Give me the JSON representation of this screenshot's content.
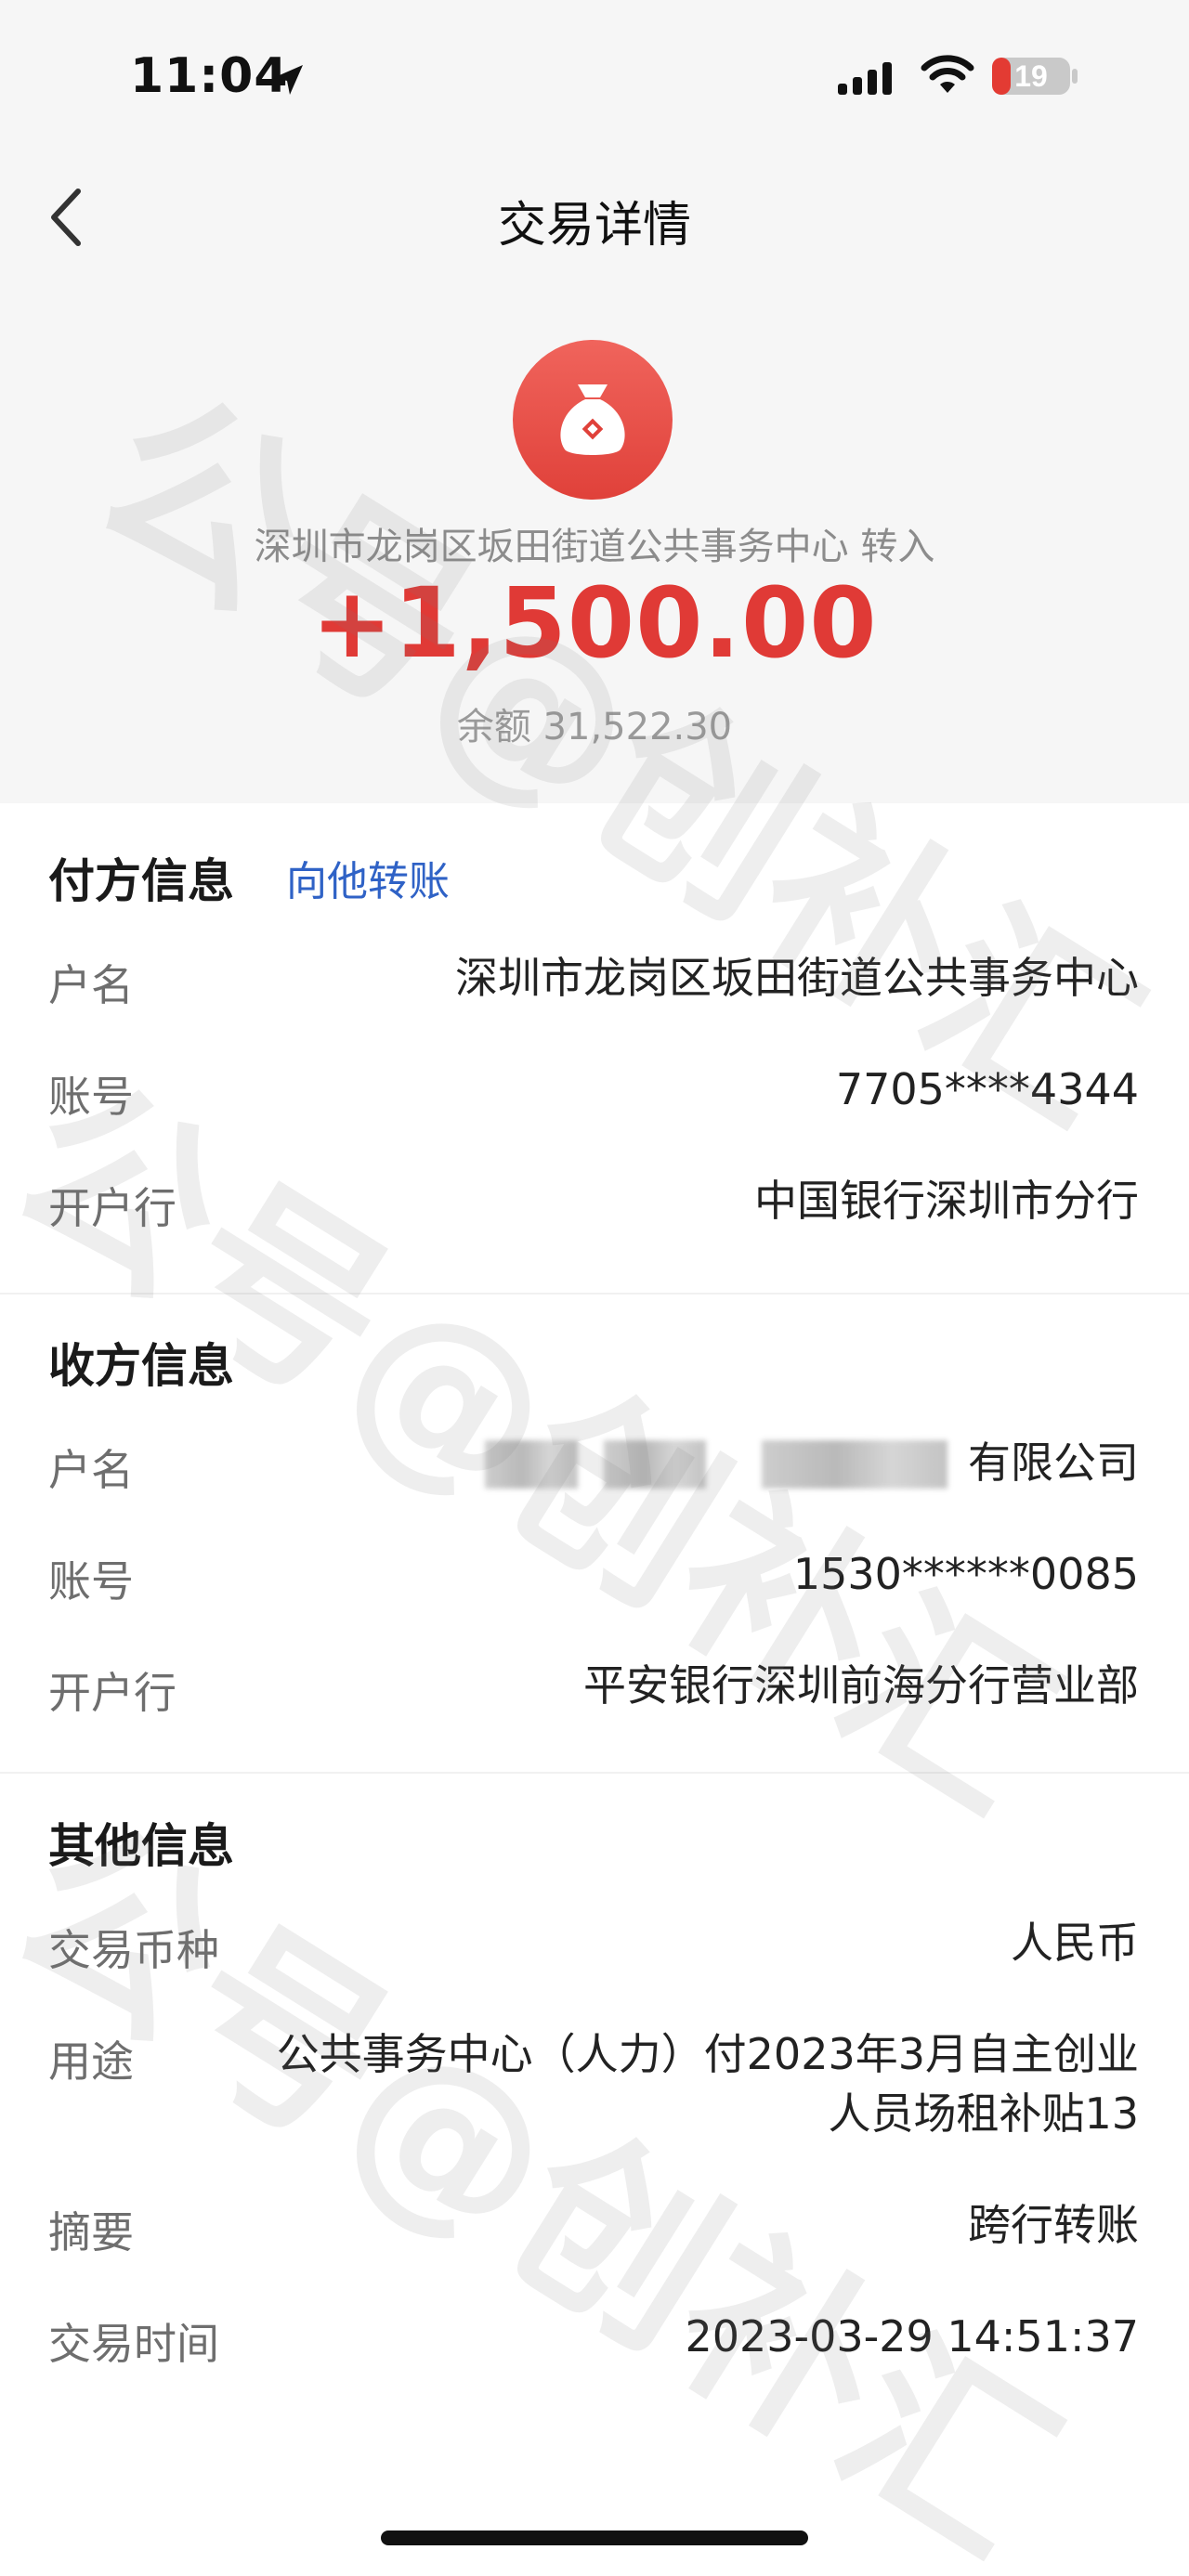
{
  "status_bar": {
    "time": "11:04",
    "battery": "19",
    "icons": [
      "location-arrow-icon",
      "cellular-signal-icon",
      "wifi-icon",
      "battery-icon"
    ]
  },
  "nav": {
    "title": "交易详情",
    "back_icon": "chevron-left-icon"
  },
  "summary": {
    "icon": "money-bag-icon",
    "counterparty_line": "深圳市龙岗区坂田街道公共事务中心  转入",
    "amount": "+1,500.00",
    "balance": "余额 31,522.30"
  },
  "payer": {
    "header": "付方信息",
    "link": "向他转账",
    "rows": [
      {
        "label": "户名",
        "value": "深圳市龙岗区坂田街道公共事务中心"
      },
      {
        "label": "账号",
        "value": "7705****4344"
      },
      {
        "label": "开户行",
        "value": "中国银行深圳市分行"
      }
    ]
  },
  "payee": {
    "header": "收方信息",
    "rows": [
      {
        "label": "户名",
        "value": "有限公司"
      },
      {
        "label": "账号",
        "value": "1530******0085"
      },
      {
        "label": "开户行",
        "value": "平安银行深圳前海分行营业部"
      }
    ]
  },
  "other": {
    "header": "其他信息",
    "rows": [
      {
        "label": "交易币种",
        "value": "人民币"
      },
      {
        "label": "用途",
        "value_line1": "公共事务中心（人力）付2023年3月自主创业",
        "value_line2": "人员场租补贴13"
      },
      {
        "label": "摘要",
        "value": "跨行转账"
      },
      {
        "label": "交易时间",
        "value": "2023-03-29 14:51:37"
      }
    ]
  },
  "watermark": {
    "text": "公号@创补汇"
  },
  "colors": {
    "amount_red": "#e03a36",
    "link_blue": "#2f62c6",
    "header_bg": "#f6f6f6"
  }
}
